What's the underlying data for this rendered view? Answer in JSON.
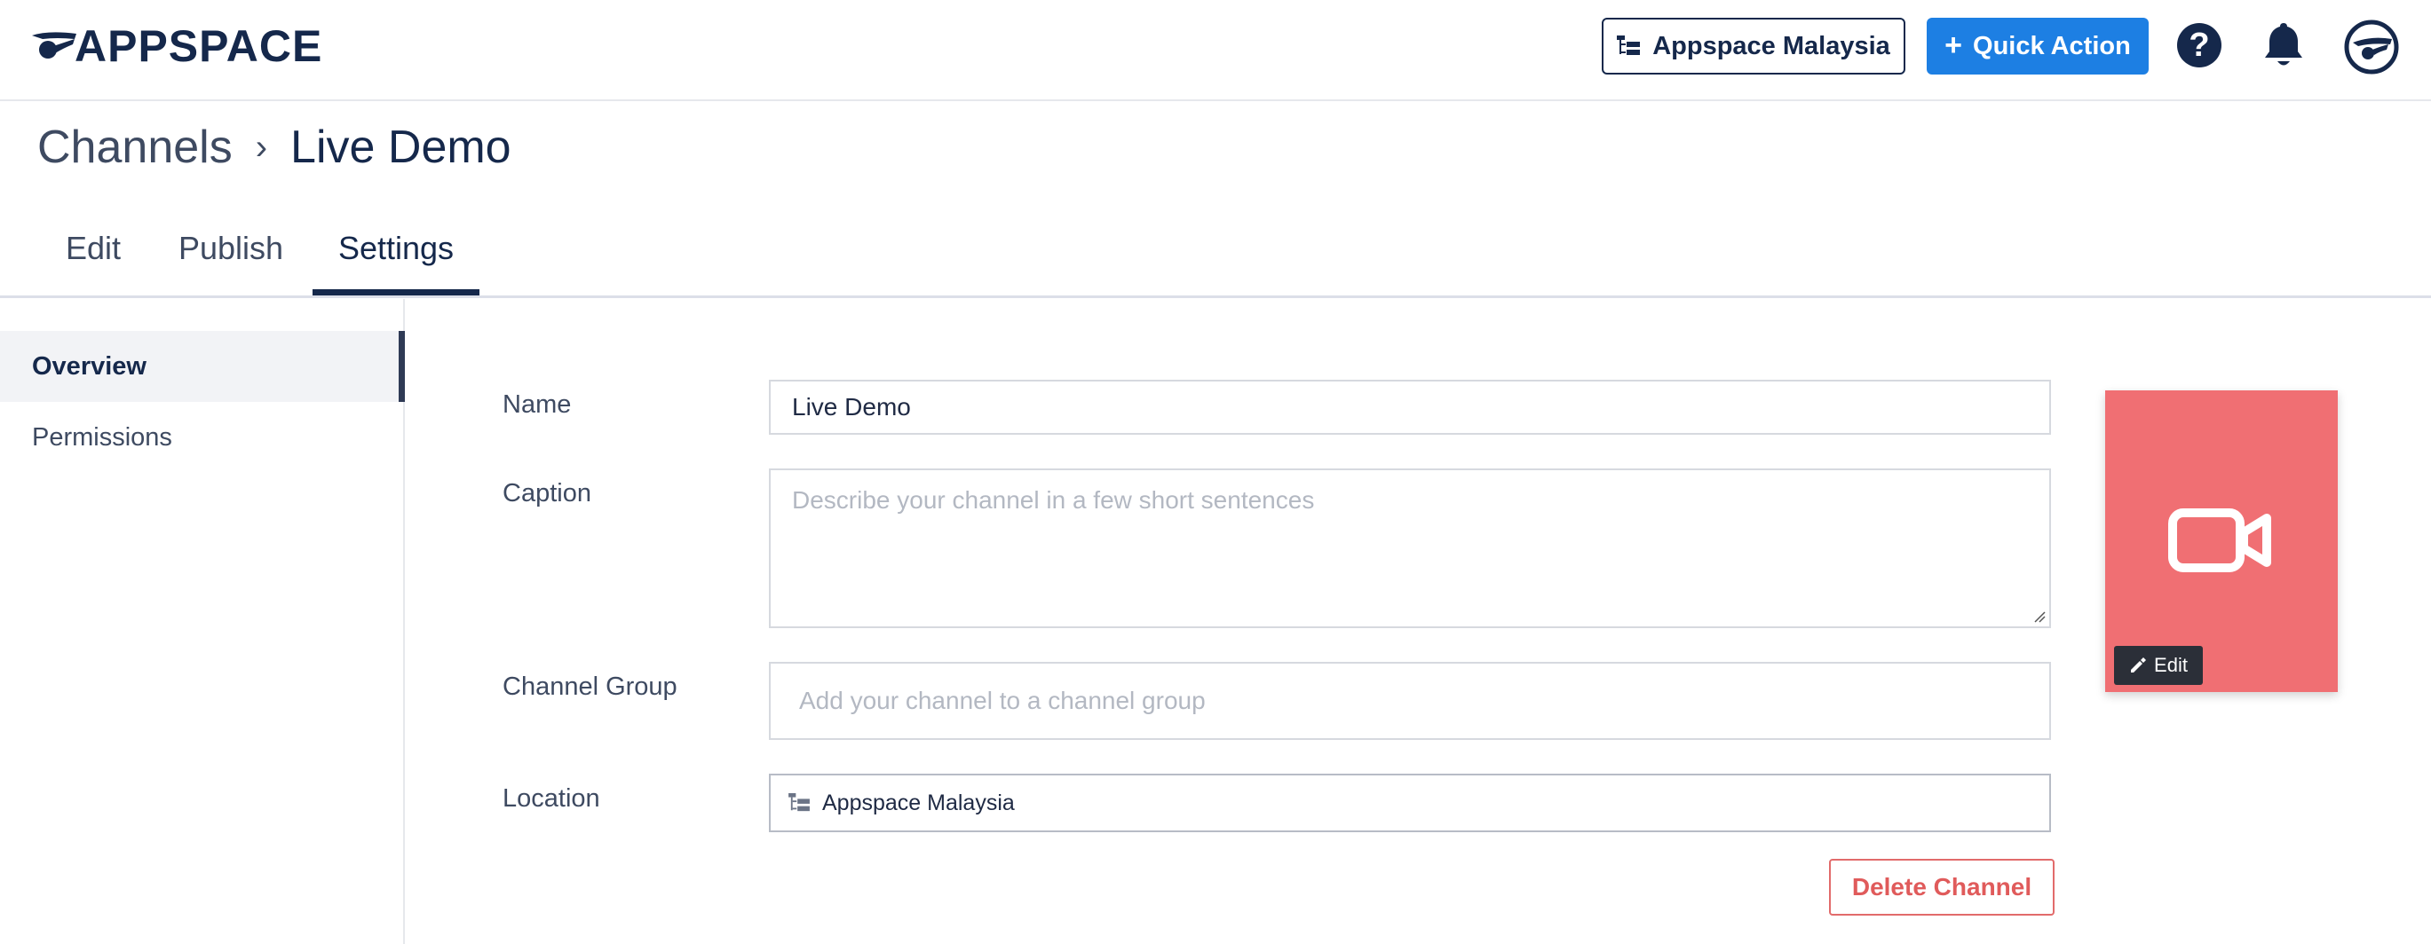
{
  "header": {
    "logo_text": "APPSPACE",
    "org_button_label": "Appspace Malaysia",
    "quick_action_label": "Quick Action",
    "help_symbol": "?"
  },
  "breadcrumb": {
    "parent": "Channels",
    "separator": "›",
    "current": "Live Demo"
  },
  "tabs": [
    {
      "label": "Edit",
      "active": false
    },
    {
      "label": "Publish",
      "active": false
    },
    {
      "label": "Settings",
      "active": true
    }
  ],
  "sidebar": {
    "items": [
      {
        "label": "Overview",
        "active": true
      },
      {
        "label": "Permissions",
        "active": false
      }
    ]
  },
  "form": {
    "name_label": "Name",
    "name_value": "Live Demo",
    "caption_label": "Caption",
    "caption_placeholder": "Describe your channel in a few short sentences",
    "group_label": "Channel Group",
    "group_placeholder": "Add your channel to a channel group",
    "location_label": "Location",
    "location_value": "Appspace Malaysia"
  },
  "thumbnail": {
    "edit_label": "Edit",
    "icon": "video-camera-icon",
    "color": "#f06f73"
  },
  "actions": {
    "delete_label": "Delete Channel"
  },
  "colors": {
    "brand_navy": "#15284b",
    "primary_blue": "#1d7fe3",
    "danger": "#e05b5b"
  }
}
